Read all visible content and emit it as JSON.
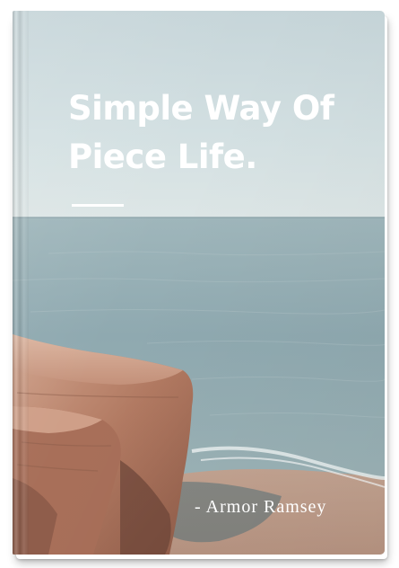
{
  "book": {
    "title_line1": "Simple Way Of",
    "title_line2": "Piece Life.",
    "author": "Armor Ramsey",
    "author_prefix": "-"
  },
  "colors": {
    "sky": "#cfdde0",
    "sea": "#8eaab2",
    "rock": "#b97d66",
    "text": "#ffffff"
  }
}
